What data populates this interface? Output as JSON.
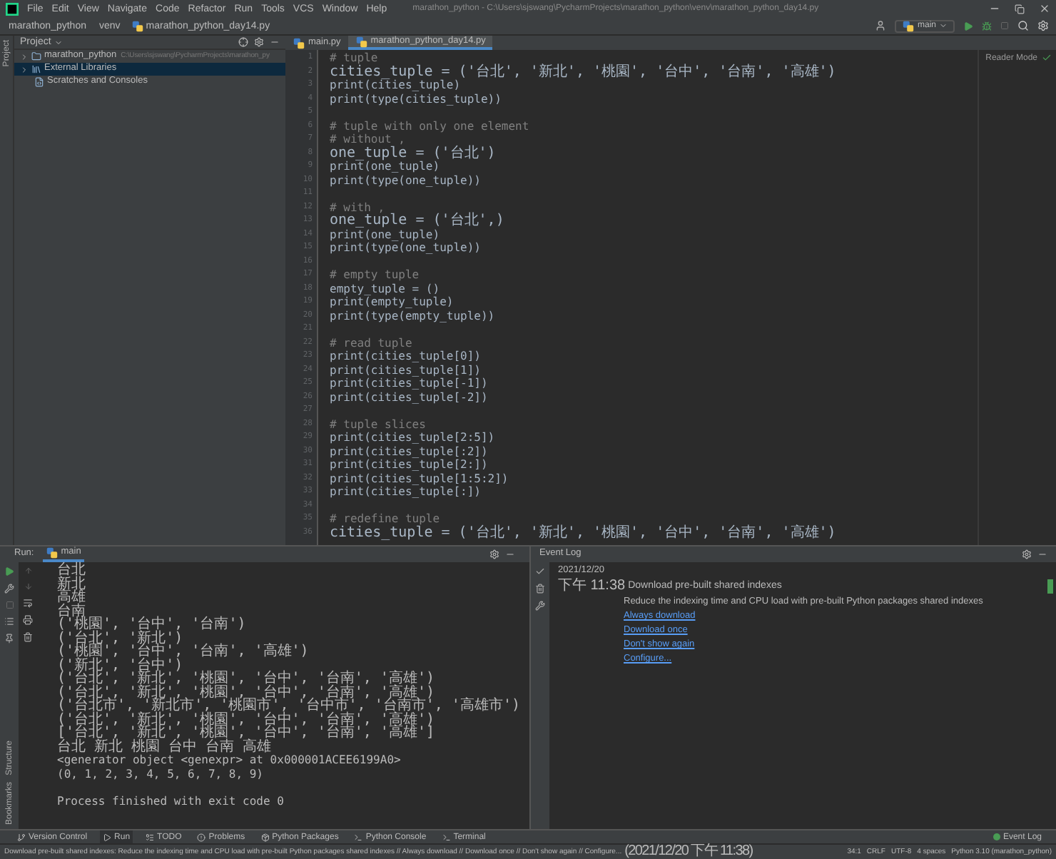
{
  "window": {
    "title": "marathon_python - C:\\Users\\sjswang\\PycharmProjects\\marathon_python\\venv\\marathon_python_day14.py"
  },
  "menu": [
    "File",
    "Edit",
    "View",
    "Navigate",
    "Code",
    "Refactor",
    "Run",
    "Tools",
    "VCS",
    "Window",
    "Help"
  ],
  "breadcrumbs": [
    "marathon_python",
    "venv",
    "marathon_python_day14.py"
  ],
  "run_config": "main",
  "left_stripe": {
    "top": [
      "Project"
    ],
    "bottom": [
      "Structure",
      "Bookmarks"
    ]
  },
  "project": {
    "header": "Project",
    "items": [
      {
        "name": "marathon_python",
        "path": "C:\\Users\\sjswang\\PycharmProjects\\marathon_py",
        "kind": "folder",
        "selected": false
      },
      {
        "name": "External Libraries",
        "kind": "library",
        "selected": true
      },
      {
        "name": "Scratches and Consoles",
        "kind": "scratch",
        "selected": false
      }
    ]
  },
  "editor": {
    "tabs": [
      {
        "label": "main.py",
        "selected": false
      },
      {
        "label": "marathon_python_day14.py",
        "selected": true
      }
    ],
    "reader_mode": "Reader Mode",
    "lines": [
      {
        "n": "1",
        "text": "# tuple",
        "kind": "comment"
      },
      {
        "n": "2",
        "text": "cities_tuple = ('台北', '新北', '桃園', '台中', '台南', '高雄')",
        "kind": "code"
      },
      {
        "n": "3",
        "text": "print(cities_tuple)",
        "kind": "code"
      },
      {
        "n": "4",
        "text": "print(type(cities_tuple))",
        "kind": "code"
      },
      {
        "n": "5",
        "kind": "blank"
      },
      {
        "n": "6",
        "text": "# tuple with only one element",
        "kind": "comment"
      },
      {
        "n": "7",
        "text": "# without ,",
        "kind": "comment"
      },
      {
        "n": "8",
        "text": "one_tuple = ('台北')",
        "kind": "code"
      },
      {
        "n": "9",
        "text": "print(one_tuple)",
        "kind": "code"
      },
      {
        "n": "10",
        "text": "print(type(one_tuple))",
        "kind": "code"
      },
      {
        "n": "11",
        "kind": "blank"
      },
      {
        "n": "12",
        "text": "# with ,",
        "kind": "comment"
      },
      {
        "n": "13",
        "text": "one_tuple = ('台北',)",
        "kind": "code"
      },
      {
        "n": "14",
        "text": "print(one_tuple)",
        "kind": "code"
      },
      {
        "n": "15",
        "text": "print(type(one_tuple))",
        "kind": "code"
      },
      {
        "n": "16",
        "kind": "blank"
      },
      {
        "n": "17",
        "text": "# empty tuple",
        "kind": "comment"
      },
      {
        "n": "18",
        "text": "empty_tuple = ()",
        "kind": "code"
      },
      {
        "n": "19",
        "text": "print(empty_tuple)",
        "kind": "code"
      },
      {
        "n": "20",
        "text": "print(type(empty_tuple))",
        "kind": "code"
      },
      {
        "n": "21",
        "kind": "blank"
      },
      {
        "n": "22",
        "text": "# read tuple",
        "kind": "comment"
      },
      {
        "n": "23",
        "text": "print(cities_tuple[0])",
        "kind": "code"
      },
      {
        "n": "24",
        "text": "print(cities_tuple[1])",
        "kind": "code"
      },
      {
        "n": "25",
        "text": "print(cities_tuple[-1])",
        "kind": "code"
      },
      {
        "n": "26",
        "text": "print(cities_tuple[-2])",
        "kind": "code"
      },
      {
        "n": "27",
        "kind": "blank"
      },
      {
        "n": "28",
        "text": "# tuple slices",
        "kind": "comment"
      },
      {
        "n": "29",
        "text": "print(cities_tuple[2:5])",
        "kind": "code"
      },
      {
        "n": "30",
        "text": "print(cities_tuple[:2])",
        "kind": "code"
      },
      {
        "n": "31",
        "text": "print(cities_tuple[2:])",
        "kind": "code"
      },
      {
        "n": "32",
        "text": "print(cities_tuple[1:5:2])",
        "kind": "code"
      },
      {
        "n": "33",
        "text": "print(cities_tuple[:])",
        "kind": "code"
      },
      {
        "n": "34",
        "kind": "blank"
      },
      {
        "n": "35",
        "text": "# redefine tuple",
        "kind": "comment"
      },
      {
        "n": "36",
        "text": "cities_tuple = ('台北', '新北', '桃園', '台中', '台南', '高雄')",
        "kind": "code"
      }
    ]
  },
  "run": {
    "label": "Run:",
    "tab": "main",
    "output": [
      {
        "text": "台北"
      },
      {
        "text": "新北"
      },
      {
        "text": "高雄"
      },
      {
        "text": "台南"
      },
      {
        "text": "('桃園', '台中', '台南')"
      },
      {
        "text": "('台北', '新北')"
      },
      {
        "text": "('桃園', '台中', '台南', '高雄')"
      },
      {
        "text": "('新北', '台中')"
      },
      {
        "text": "('台北', '新北', '桃園', '台中', '台南', '高雄')"
      },
      {
        "text": "('台北', '新北', '桃園', '台中', '台南', '高雄')"
      },
      {
        "text": "('台北市', '新北市', '桃園市', '台中市', '台南市', '高雄市')"
      },
      {
        "text": "('台北', '新北', '桃園', '台中', '台南', '高雄')"
      },
      {
        "text": "['台北', '新北', '桃園', '台中', '台南', '高雄']"
      },
      {
        "text": "台北 新北 桃園 台中 台南 高雄"
      },
      {
        "text": "<generator object <genexpr> at 0x000001ACEE6199A0>"
      },
      {
        "text": "(0, 1, 2, 3, 4, 5, 6, 7, 8, 9)"
      }
    ],
    "exit_message": "Process finished with exit code 0"
  },
  "event_log": {
    "title": "Event Log",
    "date": "2021/12/20",
    "time": "下午 11:38",
    "heading": "Download pre-built shared indexes",
    "body": "Reduce the indexing time and CPU load with pre-built Python packages shared indexes",
    "links": [
      "Always download",
      "Download once",
      "Don't show again",
      "Configure..."
    ]
  },
  "tool_windows": [
    {
      "label": "Version Control",
      "selected": false
    },
    {
      "label": "Run",
      "selected": true
    },
    {
      "label": "TODO",
      "selected": false
    },
    {
      "label": "Problems",
      "selected": false
    },
    {
      "label": "Python Packages",
      "selected": false
    },
    {
      "label": "Python Console",
      "selected": false
    },
    {
      "label": "Terminal",
      "selected": false
    }
  ],
  "event_log_button": "Event Log",
  "status_bar": {
    "message": "Download pre-built shared indexes: Reduce the indexing time and CPU load with pre-built Python packages shared indexes // Always download // Download once // Don't show again // Configure...",
    "time": "(2021/12/20 下午 11:38)",
    "items": [
      "34:1",
      "CRLF",
      "UTF-8",
      "4 spaces",
      "Python 3.10 (marathon_python)"
    ]
  }
}
